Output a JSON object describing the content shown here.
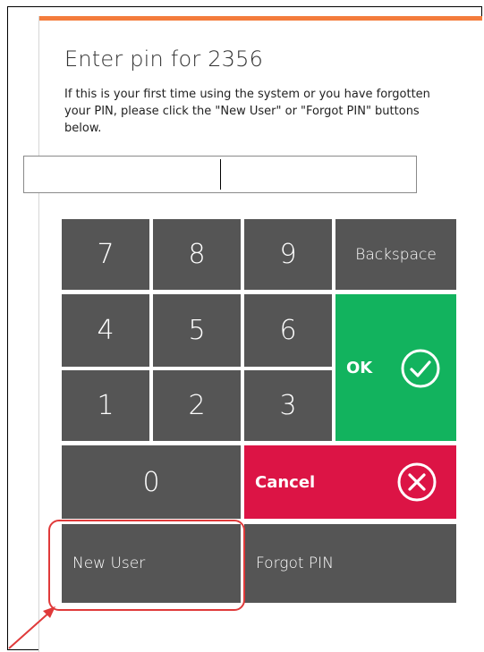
{
  "dialog": {
    "title": "Enter pin for 2356",
    "instructions": "If this is your first time using the system or you have forgotten your PIN, please click the \"New User\" or \"Forgot PIN\" buttons below.",
    "pin_value": ""
  },
  "keypad": {
    "k7": "7",
    "k8": "8",
    "k9": "9",
    "k4": "4",
    "k5": "5",
    "k6": "6",
    "k1": "1",
    "k2": "2",
    "k3": "3",
    "k0": "0",
    "backspace": "Backspace",
    "ok": "OK",
    "cancel": "Cancel",
    "new_user": "New User",
    "forgot_pin": "Forgot PIN"
  },
  "colors": {
    "accent_bar": "#f47c3c",
    "key": "#555555",
    "ok": "#12b35e",
    "cancel": "#dc1445",
    "annotation": "#e03a3a"
  },
  "icons": {
    "ok": "check-circle-icon",
    "cancel": "x-circle-icon",
    "annotation": "arrow-icon"
  }
}
